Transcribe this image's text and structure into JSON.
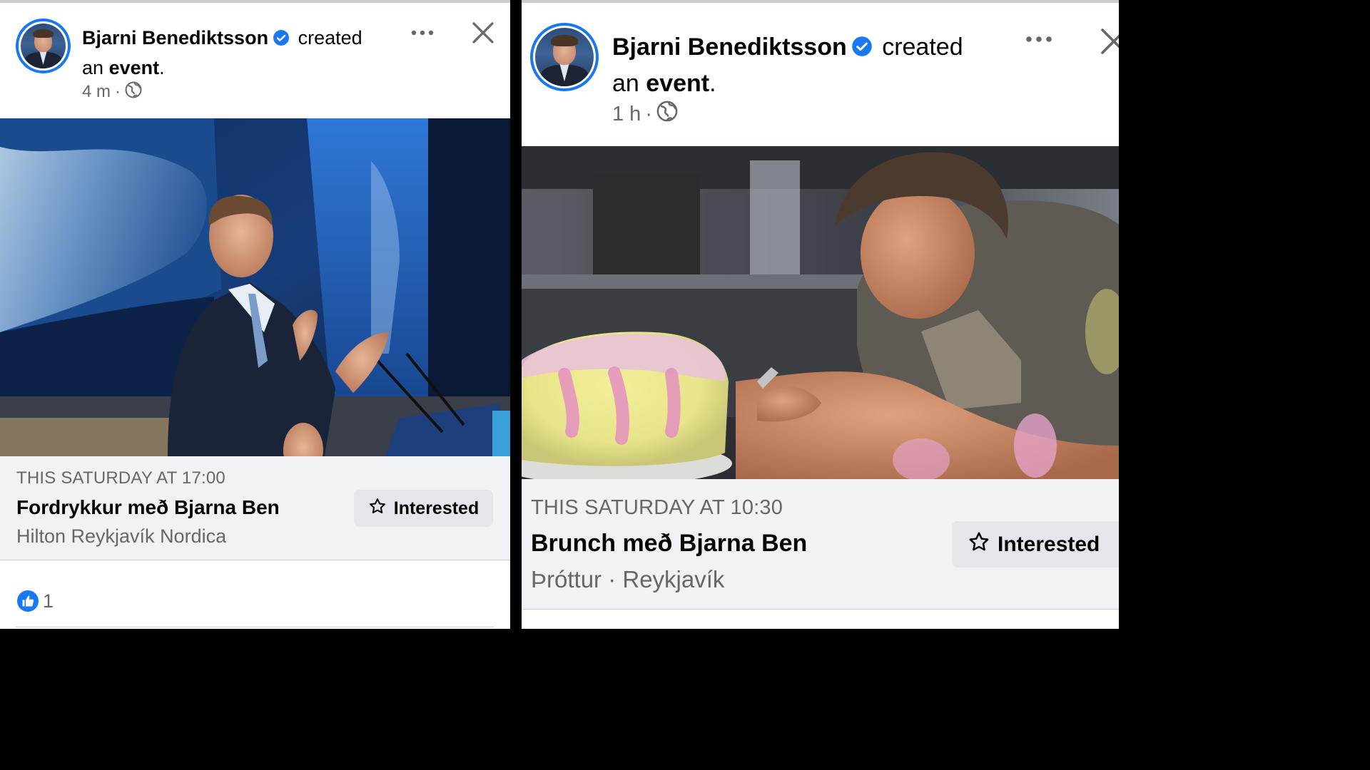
{
  "posts": [
    {
      "author": "Bjarni Benediktsson",
      "action_prefix": "created",
      "action_line2_a": "an",
      "action_object": "event",
      "action_end": ".",
      "time": "4 m",
      "dot": "·",
      "event": {
        "datetime": "THIS SATURDAY AT 17:00",
        "title": "Fordrykkur með Bjarna Ben",
        "location": "Hilton Reykjavík Nordica",
        "interested_label": "Interested"
      },
      "reactions": {
        "count": "1"
      }
    },
    {
      "author": "Bjarni Benediktsson",
      "action_prefix": "created",
      "action_line2_a": "an",
      "action_object": "event",
      "action_end": ".",
      "time": "1 h",
      "dot": "·",
      "event": {
        "datetime": "THIS SATURDAY AT 10:30",
        "title": "Brunch með Bjarna Ben",
        "location": "Þróttur · Reykjavík",
        "interested_label": "Interested"
      }
    }
  ],
  "colors": {
    "accent": "#1877f2",
    "secondary_text": "#65676b",
    "event_bg": "#f0f2f5",
    "button_bg": "#e4e6eb"
  },
  "icons": [
    "verified-badge-icon",
    "globe-icon",
    "more-options-icon",
    "close-icon",
    "star-icon",
    "like-icon"
  ]
}
